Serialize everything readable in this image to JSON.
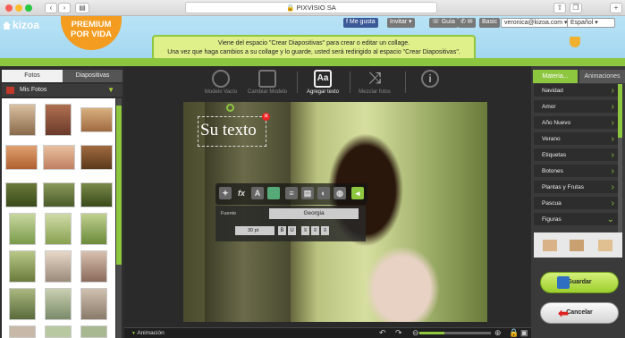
{
  "browser": {
    "url": "PIXVISIO SA"
  },
  "site": {
    "logo": "kizoa",
    "premium_line1": "PREMIUM",
    "premium_line2": "POR VIDA",
    "like": "Me gusta",
    "invite": "Invitar",
    "guide": "Guía",
    "plan": "Basic",
    "email": "veronica@kizoa.com",
    "language": "Español",
    "notice_line1": "Viene del espacio \"Crear Diapositivas\" para crear o editar un collage.",
    "notice_line2": "Una vez que haga cambios a su collage y lo guarde, usted será redirigido al espacio \"Crear Diapositivas\"."
  },
  "left_panel": {
    "tab_fotos": "Fotos",
    "tab_diapositivas": "Diapositivas",
    "folder": "Mis Fotos"
  },
  "toolbar": {
    "modelo_vacio": "Modelo Vacío",
    "cambiar_modelo": "Cambiar Modelo",
    "agregar_texto": "Agregar texto",
    "agregar_texto_icon": "Aa",
    "mezclar_fotos": "Mezclar fotos"
  },
  "canvas": {
    "text": "Su texto",
    "font_label": "Fuente",
    "font_name": "Georgia",
    "font_size": "30 pt"
  },
  "bottom": {
    "animacion": "Animación"
  },
  "right_panel": {
    "tab_materia": "Materia...",
    "tab_animaciones": "Animaciones",
    "categories": [
      "Navidad",
      "Amor",
      "Año Nuevo",
      "Verano",
      "Etiquetas",
      "Botones",
      "Plantas y Frutas",
      "Pascua",
      "Figuras"
    ],
    "save": "Guardar",
    "cancel": "Cancelar"
  },
  "colors": {
    "accent_green": "#8dc63f",
    "premium_orange": "#f39c1f"
  }
}
